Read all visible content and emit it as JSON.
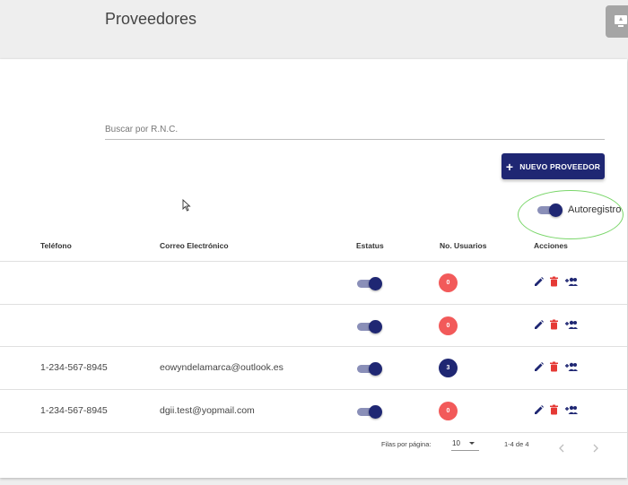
{
  "header": {
    "title": "Proveedores"
  },
  "search": {
    "placeholder": "Buscar por R.N.C.",
    "value": ""
  },
  "toolbar": {
    "new_label": "NUEVO PROVEEDOR"
  },
  "autoregistro": {
    "label": "Autoregistro",
    "enabled": true
  },
  "table": {
    "columns": {
      "phone": "Teléfono",
      "email": "Correo Electrónico",
      "status": "Estatus",
      "users": "No. Usuarios",
      "actions": "Acciones"
    },
    "rows": [
      {
        "phone": "",
        "email": "",
        "status": true,
        "users": "0",
        "users_color": "#f25a5a"
      },
      {
        "phone": "",
        "email": "",
        "status": true,
        "users": "0",
        "users_color": "#f25a5a"
      },
      {
        "phone": "1-234-567-8945",
        "email": "eowyndelamarca@outlook.es",
        "status": true,
        "users": "3",
        "users_color": "#1f2773"
      },
      {
        "phone": "1-234-567-8945",
        "email": "dgii.test@yopmail.com",
        "status": true,
        "users": "0",
        "users_color": "#f25a5a"
      }
    ]
  },
  "pagination": {
    "rows_label": "Filas por página:",
    "rows_value": "10",
    "range": "1-4 de 4"
  },
  "icons": {
    "edit": "pencil-icon",
    "delete": "trash-icon",
    "add_user": "add-users-icon",
    "corner": "monitor-icon"
  },
  "colors": {
    "primary": "#1f2773",
    "danger": "#e53935",
    "badge_zero": "#f25a5a",
    "annotation": "#7ad66a"
  }
}
